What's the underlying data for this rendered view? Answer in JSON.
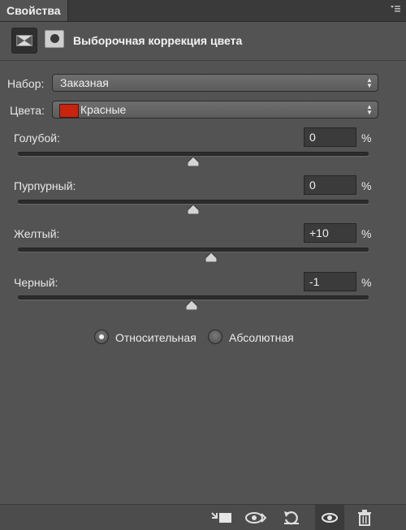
{
  "panel": {
    "tab_title": "Свойства",
    "menu_icon": "panel-menu-icon"
  },
  "header": {
    "title": "Выборочная коррекция цвета",
    "adjustment_icon": "selective-color-icon",
    "mask_icon": "mask-icon"
  },
  "preset": {
    "label": "Набор:",
    "value": "Заказная"
  },
  "colors": {
    "label": "Цвета:",
    "value": "Красные",
    "swatch_color": "#c8240e"
  },
  "sliders": [
    {
      "label": "Голубой:",
      "value": "0",
      "unit": "%",
      "level": 0
    },
    {
      "label": "Пурпурный:",
      "value": "0",
      "unit": "%",
      "level": 0
    },
    {
      "label": "Желтый:",
      "value": "+10",
      "unit": "%",
      "level": 10
    },
    {
      "label": "Черный:",
      "value": "-1",
      "unit": "%",
      "level": -1
    }
  ],
  "method": {
    "relative_label": "Относительная",
    "absolute_label": "Абсолютная",
    "selected": "relative"
  },
  "bottom_toolbar": {
    "icons": [
      "clip-to-layer-icon",
      "view-previous-state-icon",
      "reset-icon",
      "toggle-visibility-icon",
      "delete-icon"
    ]
  }
}
